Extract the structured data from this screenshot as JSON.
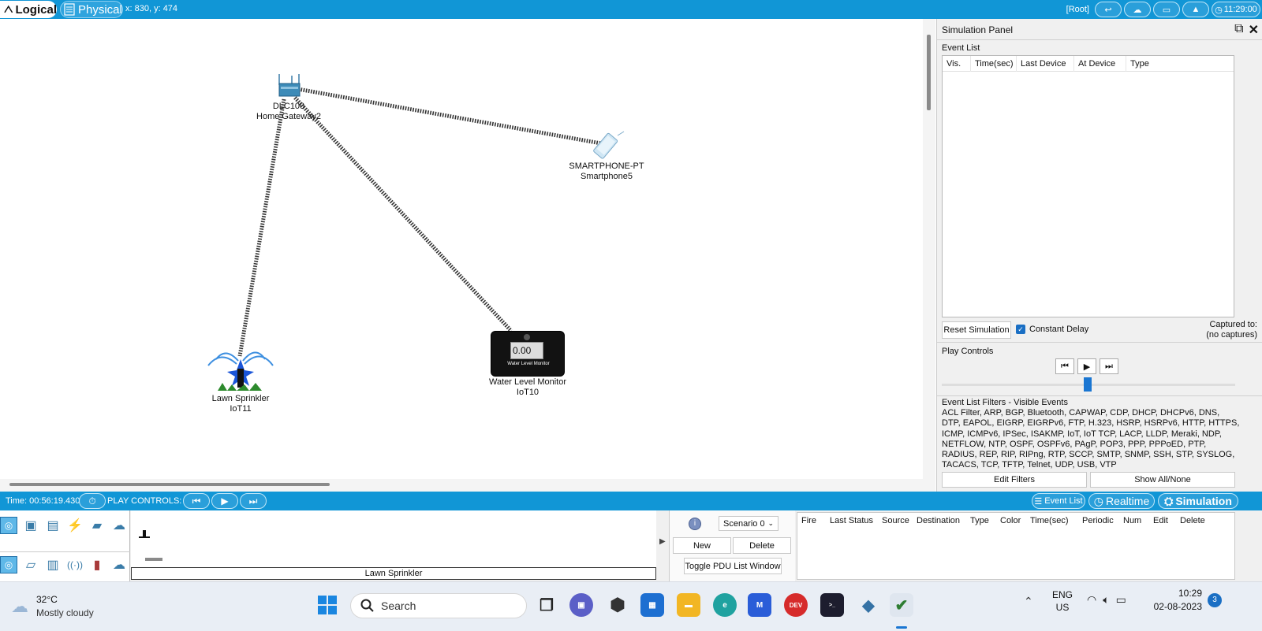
{
  "topbar": {
    "logical_label": "Logical",
    "physical_label": "Physical",
    "coords": "x: 830, y: 474",
    "root_label": "[Root]",
    "clock": "11:29:00"
  },
  "devices": {
    "gateway": {
      "model": "DLC100",
      "name": "Home Gateway2"
    },
    "smartphone": {
      "model": "SMARTPHONE-PT",
      "name": "Smartphone5"
    },
    "water_monitor": {
      "model": "Water Level Monitor",
      "name": "IoT10",
      "display_value": "0.00",
      "screen_caption": "Water Level Monitor"
    },
    "sprinkler": {
      "model": "Lawn Sprinkler",
      "name": "IoT11"
    }
  },
  "sim_panel": {
    "title": "Simulation Panel",
    "event_list_label": "Event List",
    "columns": [
      "Vis.",
      "Time(sec)",
      "Last Device",
      "At Device",
      "Type"
    ],
    "reset_button": "Reset Simulation",
    "constant_delay_label": "Constant Delay",
    "captured_to_label": "Captured to:",
    "captured_to_value": "(no captures)",
    "play_controls_label": "Play Controls",
    "filters_label": "Event List Filters - Visible Events",
    "filters_text": "ACL Filter, ARP, BGP, Bluetooth, CAPWAP, CDP, DHCP, DHCPv6, DNS, DTP, EAPOL, EIGRP, EIGRPv6, FTP, H.323, HSRP, HSRPv6, HTTP, HTTPS, ICMP, ICMPv6, IPSec, ISAKMP, IoT, IoT TCP, LACP, LLDP, Meraki, NDP, NETFLOW, NTP, OSPF, OSPFv6, PAgP, POP3, PPP, PPPoED, PTP, RADIUS, REP, RIP, RIPng, RTP, SCCP, SMTP, SNMP, SSH, STP, SYSLOG, TACACS, TCP, TFTP, Telnet, UDP, USB, VTP",
    "edit_filters_button": "Edit Filters",
    "show_all_button": "Show All/None"
  },
  "bottombar": {
    "time": "Time: 00:56:19.430",
    "play_controls": "PLAY CONTROLS:",
    "event_list_button": "Event List",
    "realtime_button": "Realtime",
    "simulation_button": "Simulation"
  },
  "bottompane": {
    "selected_device_label": "Lawn Sprinkler",
    "scenario_value": "Scenario 0",
    "new_button": "New",
    "delete_button": "Delete",
    "toggle_pdu_button": "Toggle PDU List Window",
    "pdu_columns": [
      "Fire",
      "Last Status",
      "Source",
      "Destination",
      "Type",
      "Color",
      "Time(sec)",
      "Periodic",
      "Num",
      "Edit",
      "Delete"
    ]
  },
  "taskbar": {
    "weather_temp": "32°C",
    "weather_desc": "Mostly cloudy",
    "search_placeholder": "Search",
    "lang_line1": "ENG",
    "lang_line2": "US",
    "time": "10:29",
    "date": "02-08-2023",
    "notification_count": "3"
  },
  "colors": {
    "accent_blue": "#1196d6",
    "link_dash": "#333333"
  }
}
